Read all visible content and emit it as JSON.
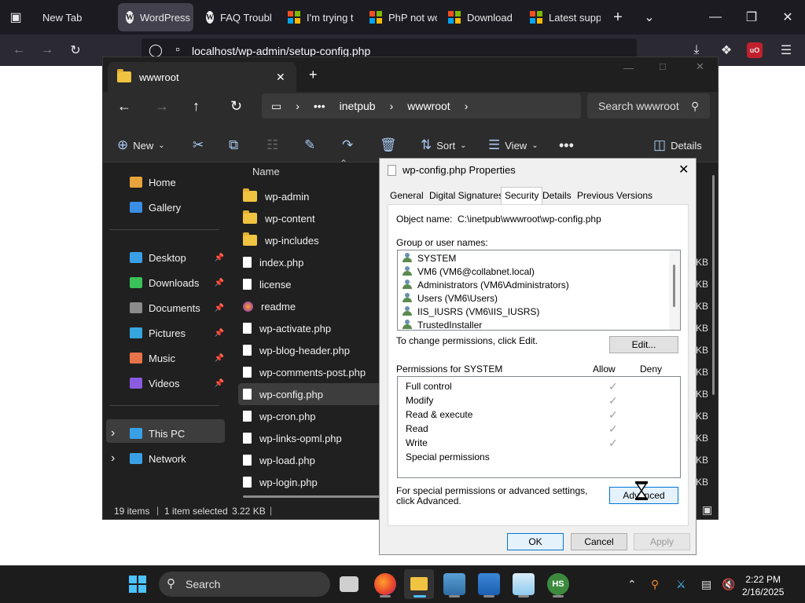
{
  "browser": {
    "tabs": [
      {
        "label": "New Tab",
        "icon": "firefox-view-icon"
      },
      {
        "label": "WordPress ›",
        "icon": "wordpress-icon",
        "active": true
      },
      {
        "label": "FAQ Troubl",
        "icon": "wordpress-icon"
      },
      {
        "label": "I'm trying t",
        "icon": "microsoft-icon"
      },
      {
        "label": "PhP not wo",
        "icon": "microsoft-icon"
      },
      {
        "label": "Download",
        "icon": "microsoft-icon"
      },
      {
        "label": "Latest supp",
        "icon": "microsoft-icon"
      }
    ],
    "url": "localhost/wp-admin/setup-config.php"
  },
  "explorer": {
    "tab_title": "wwwroot",
    "breadcrumb": [
      "•••",
      "inetpub",
      "wwwroot"
    ],
    "search_placeholder": "Search wwwroot",
    "toolbar": {
      "new": "New",
      "sort": "Sort",
      "view": "View",
      "details": "Details"
    },
    "sidebar": [
      {
        "label": "Home",
        "icon": "home-icon",
        "color": "#e8a33c"
      },
      {
        "label": "Gallery",
        "icon": "gallery-icon",
        "color": "#3a8ee6"
      },
      {
        "label": "Desktop",
        "icon": "desktop-icon",
        "color": "#3aa0e6",
        "pinned": true
      },
      {
        "label": "Downloads",
        "icon": "downloads-icon",
        "color": "#3bc15a",
        "pinned": true
      },
      {
        "label": "Documents",
        "icon": "documents-icon",
        "color": "#8b8b8b",
        "pinned": true
      },
      {
        "label": "Pictures",
        "icon": "pictures-icon",
        "color": "#36a6e0",
        "pinned": true
      },
      {
        "label": "Music",
        "icon": "music-icon",
        "color": "#e8734a",
        "pinned": true
      },
      {
        "label": "Videos",
        "icon": "videos-icon",
        "color": "#8a5be0",
        "pinned": true
      },
      {
        "label": "This PC",
        "icon": "this-pc-icon",
        "color": "#3aa0e6"
      },
      {
        "label": "Network",
        "icon": "network-icon",
        "color": "#3aa0e6"
      }
    ],
    "column_name": "Name",
    "files": [
      {
        "name": "wp-admin",
        "type": "folder"
      },
      {
        "name": "wp-content",
        "type": "folder"
      },
      {
        "name": "wp-includes",
        "type": "folder"
      },
      {
        "name": "index.php",
        "type": "file"
      },
      {
        "name": "license",
        "type": "file"
      },
      {
        "name": "readme",
        "type": "firefox"
      },
      {
        "name": "wp-activate.php",
        "type": "file"
      },
      {
        "name": "wp-blog-header.php",
        "type": "file"
      },
      {
        "name": "wp-comments-post.php",
        "type": "file"
      },
      {
        "name": "wp-config.php",
        "type": "file",
        "selected": true
      },
      {
        "name": "wp-cron.php",
        "type": "file"
      },
      {
        "name": "wp-links-opml.php",
        "type": "file"
      },
      {
        "name": "wp-load.php",
        "type": "file"
      },
      {
        "name": "wp-login.php",
        "type": "file"
      }
    ],
    "size_unit": "KB",
    "status": {
      "items": "19 items",
      "selected": "1 item selected",
      "size": "3.22 KB"
    }
  },
  "dialog": {
    "title": "wp-config.php Properties",
    "tabs": [
      "General",
      "Digital Signatures",
      "Security",
      "Details",
      "Previous Versions"
    ],
    "object_label": "Object name:",
    "object_value": "C:\\inetpub\\wwwroot\\wp-config.php",
    "group_label": "Group or user names:",
    "users": [
      "SYSTEM",
      "VM6 (VM6@collabnet.local)",
      "Administrators (VM6\\Administrators)",
      "Users (VM6\\Users)",
      "IIS_IUSRS (VM6\\IIS_IUSRS)",
      "TrustedInstaller"
    ],
    "change_text": "To change permissions, click Edit.",
    "edit_button": "Edit...",
    "perm_label": "Permissions for SYSTEM",
    "allow": "Allow",
    "deny": "Deny",
    "permissions": [
      {
        "name": "Full control",
        "allow": true
      },
      {
        "name": "Modify",
        "allow": true
      },
      {
        "name": "Read & execute",
        "allow": true
      },
      {
        "name": "Read",
        "allow": true
      },
      {
        "name": "Write",
        "allow": true
      },
      {
        "name": "Special permissions",
        "allow": false
      }
    ],
    "advanced_text": "For special permissions or advanced settings, click Advanced.",
    "advanced_button": "Advanced",
    "ok": "OK",
    "cancel": "Cancel",
    "apply": "Apply"
  },
  "taskbar": {
    "search": "Search",
    "time": "2:22 PM",
    "date": "2/16/2025",
    "accent": "#4cc2ff"
  }
}
